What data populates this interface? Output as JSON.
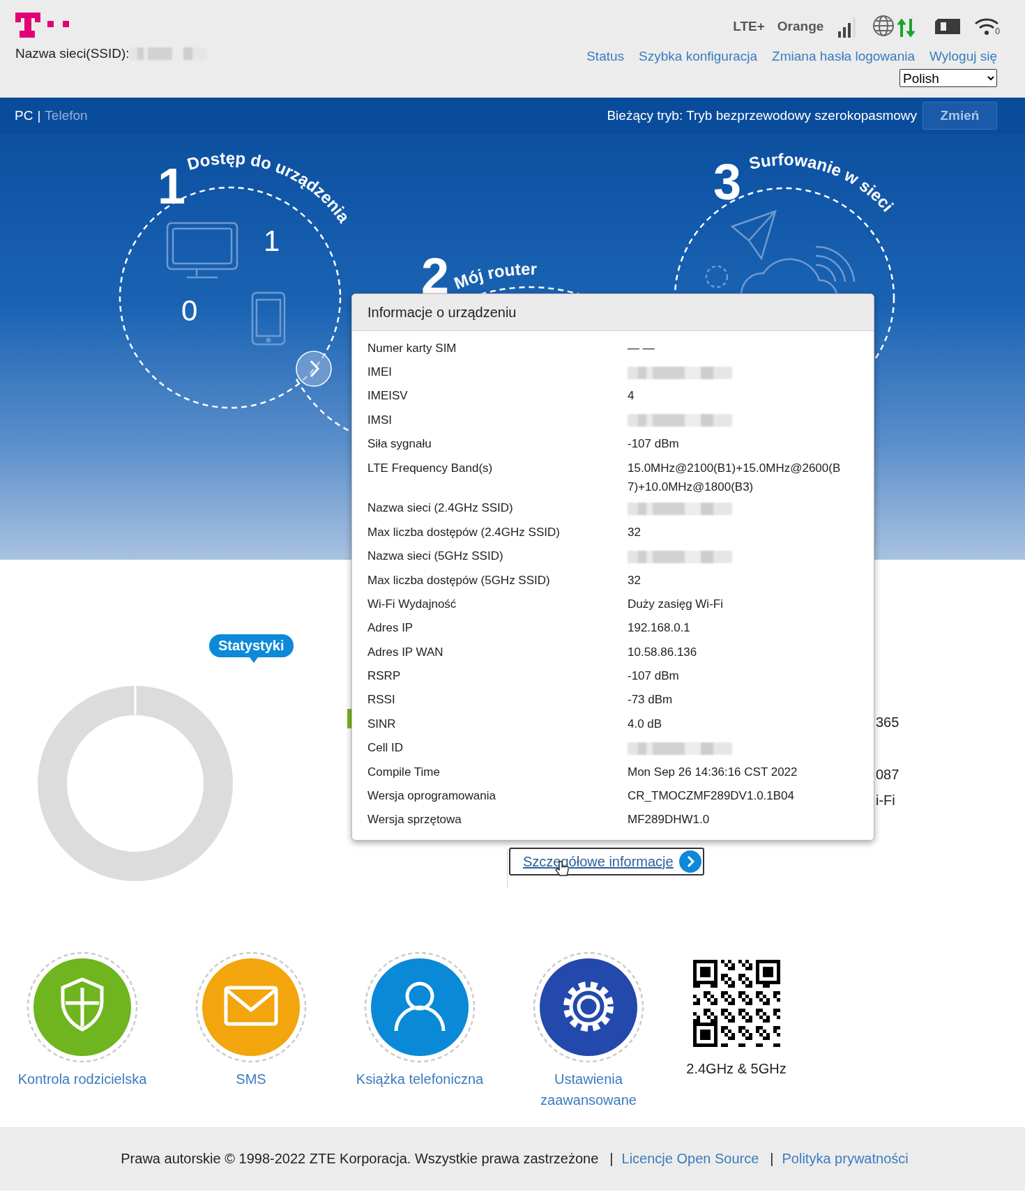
{
  "header": {
    "ssid_label": "Nazwa sieci(SSID):",
    "ssid_redacted": true,
    "network_type": "LTE+",
    "operator": "Orange",
    "wifi_clients": "0",
    "nav": [
      "Status",
      "Szybka konfiguracja",
      "Zmiana hasła logowania",
      "Wyloguj się"
    ],
    "language": "Polish"
  },
  "mode_bar": {
    "views": [
      {
        "label": "PC",
        "selected": true
      },
      {
        "label": "Telefon",
        "selected": false
      }
    ],
    "separator": "|",
    "mode_text": "Bieżący tryb: Tryb bezprzewodowy szerokopasmowy",
    "change_button": "Zmień"
  },
  "steps": [
    {
      "number": "1",
      "title": "Dostęp do urządzenia"
    },
    {
      "number": "2",
      "title": "Mój router"
    },
    {
      "number": "3",
      "title": "Surfowanie w sieci"
    }
  ],
  "devices": {
    "pc_count": "1",
    "phone_count": "0"
  },
  "stats": {
    "badge": "Statystyki",
    "fragments": [
      "365",
      "087",
      "i-Fi"
    ],
    "details_link": "Szczegółowe informacje"
  },
  "device_info": {
    "title": "Informacje o urządzeniu",
    "rows": [
      {
        "label": "Numer karty SIM",
        "value": "— —"
      },
      {
        "label": "IMEI",
        "redacted": true
      },
      {
        "label": "IMEISV",
        "value": "4"
      },
      {
        "label": "IMSI",
        "redacted": true
      },
      {
        "label": "Siła sygnału",
        "value": "-107 dBm"
      },
      {
        "label": "LTE Frequency Band(s)",
        "value": "15.0MHz@2100(B1)+15.0MHz@2600(B7)+10.0MHz@1800(B3)"
      },
      {
        "label": "Nazwa sieci (2.4GHz SSID)",
        "redacted": true
      },
      {
        "label": "Max liczba dostępów (2.4GHz SSID)",
        "value": "32"
      },
      {
        "label": "Nazwa sieci (5GHz SSID)",
        "redacted": true
      },
      {
        "label": "Max liczba dostępów (5GHz SSID)",
        "value": "32"
      },
      {
        "label": "Wi-Fi Wydajność",
        "value": "Duży zasięg Wi-Fi"
      },
      {
        "label": "Adres IP",
        "value": "192.168.0.1"
      },
      {
        "label": "Adres IP WAN",
        "value": "10.58.86.136"
      },
      {
        "label": "RSRP",
        "value": "-107 dBm"
      },
      {
        "label": "RSSI",
        "value": "-73 dBm"
      },
      {
        "label": "SINR",
        "value": "4.0 dB"
      },
      {
        "label": "Cell ID",
        "redacted": true
      },
      {
        "label": "Compile Time",
        "value": "Mon Sep 26 14:36:16 CST 2022"
      },
      {
        "label": "Wersja oprogramowania",
        "value": "CR_TMOCZMF289DV1.0.1B04"
      },
      {
        "label": "Wersja sprzętowa",
        "value": "MF289DHW1.0"
      }
    ]
  },
  "shortcuts": [
    {
      "kind": "shield",
      "label": "Kontrola rodzicielska"
    },
    {
      "kind": "mail",
      "label": "SMS"
    },
    {
      "kind": "person",
      "label": "Książka telefoniczna"
    },
    {
      "kind": "gear",
      "label": "Ustawienia zaawansowane"
    },
    {
      "kind": "qr",
      "label": "2.4GHz & 5GHz"
    }
  ],
  "footer": {
    "copyright": "Prawa autorskie © 1998-2022 ZTE Korporacja. Wszystkie prawa zastrzeżone",
    "separator": "|",
    "links": [
      "Licencje Open Source",
      "Polityka prywatności"
    ]
  }
}
